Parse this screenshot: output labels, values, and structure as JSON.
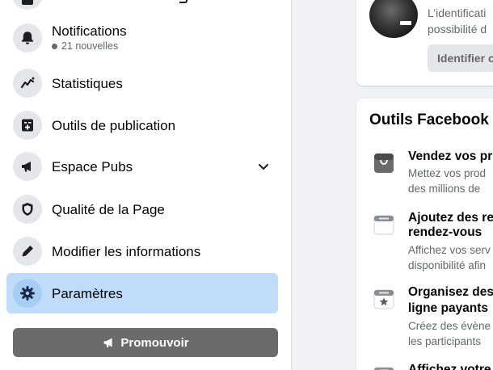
{
  "sidebar": {
    "items": [
      {
        "label": "Notifications",
        "sub": "21 nouvelles",
        "icon": "bell-icon"
      },
      {
        "label": "Statistiques",
        "icon": "chart-line-icon"
      },
      {
        "label": "Outils de publication",
        "icon": "publishing-tools-icon"
      },
      {
        "label": "Espace Pubs",
        "icon": "megaphone-icon"
      },
      {
        "label": "Qualité de la Page",
        "icon": "shield-icon"
      },
      {
        "label": "Modifier les informations",
        "icon": "pencil-icon"
      },
      {
        "label": "Paramètres",
        "icon": "gear-icon",
        "active": true
      }
    ],
    "promote_label": "Promouvoir"
  },
  "identify_card": {
    "text_line1": "L’identificati",
    "text_line2": "possibilité d",
    "button_label": "Identifier c"
  },
  "tools_card": {
    "title": "Outils Facebook",
    "items": [
      {
        "title_line1": "Vendez vos pr",
        "desc_line1": "Mettez vos prod",
        "desc_line2": "des millions de ",
        "icon": "shop-bag-icon"
      },
      {
        "title_line1": "Ajoutez des re",
        "title_line2": "rendez-vous",
        "desc_line1": "Affichez vos serv",
        "desc_line2": "disponibilité afin",
        "icon": "calendar-icon"
      },
      {
        "title_line1": "Organisez des",
        "title_line2": "ligne payants",
        "desc_line1": "Créez des évène",
        "desc_line2": "les participants ",
        "icon": "event-star-icon"
      },
      {
        "title_line1": "Affichez votre",
        "icon": "calendar-icon"
      }
    ]
  },
  "colors": {
    "active_background": "#bfdcfa",
    "promote_button": "#6b6b6b",
    "page_background": "#f0f2f5"
  }
}
